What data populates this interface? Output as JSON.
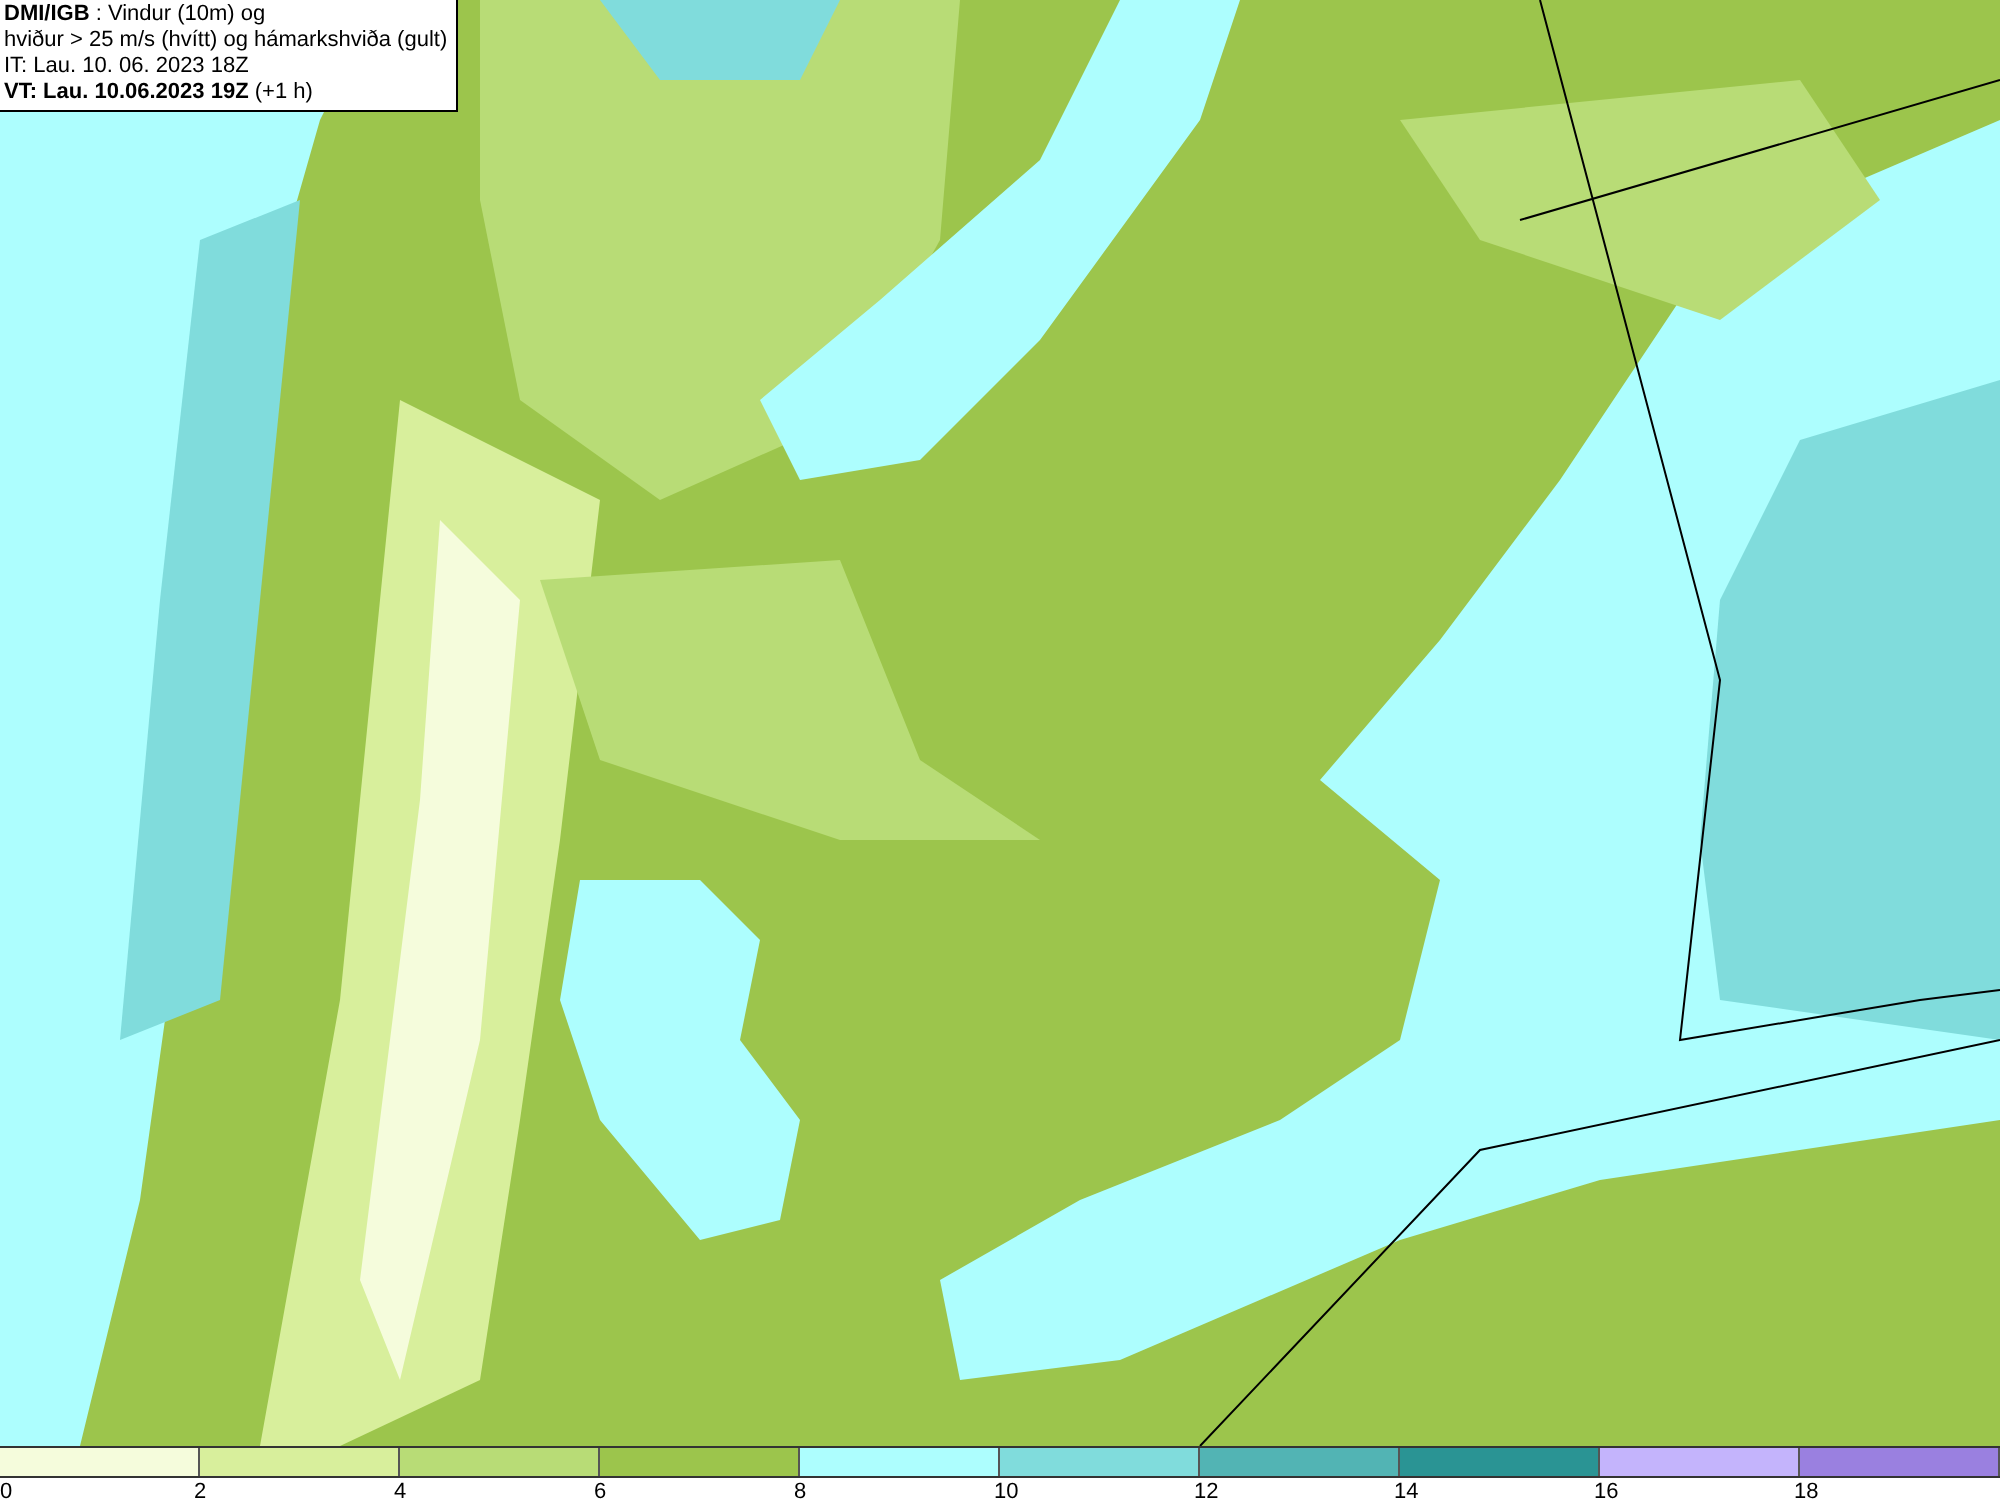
{
  "header": {
    "lines": [
      "**DMI/IGB** : Vindur (10m) og",
      "hviður > 25 m/s (hvítt) og hámarkshviða (gult)",
      "IT: Lau. 10. 06. 2023 18Z",
      "**VT: Lau. 10.06.2023 19Z** (+1 h)"
    ]
  },
  "legend": [
    {
      "label": "0",
      "color": "#f5fcdc"
    },
    {
      "label": "2",
      "color": "#d8ef9c"
    },
    {
      "label": "4",
      "color": "#b8dc76"
    },
    {
      "label": "6",
      "color": "#9cc54c"
    },
    {
      "label": "8",
      "color": "#adfefe"
    },
    {
      "label": "10",
      "color": "#80dcdc"
    },
    {
      "label": "12",
      "color": "#52b4b4"
    },
    {
      "label": "14",
      "color": "#2a9494"
    },
    {
      "label": "16",
      "color": "#c4b4fc"
    },
    {
      "label": "18",
      "color": "#9a80e0"
    }
  ]
}
